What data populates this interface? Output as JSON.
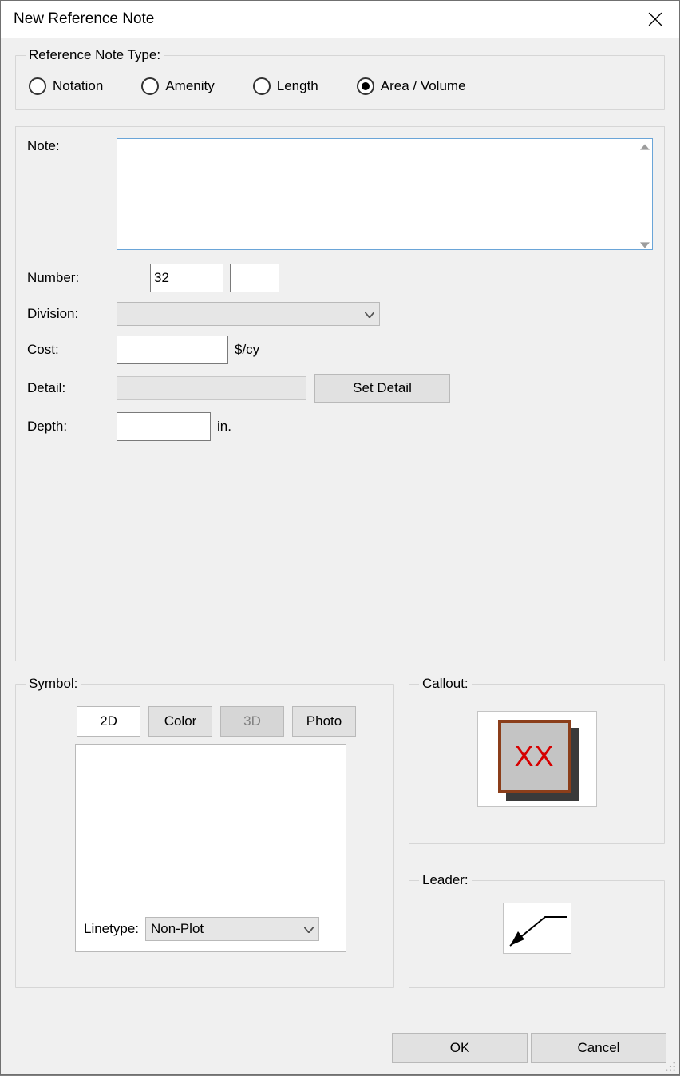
{
  "window": {
    "title": "New Reference Note"
  },
  "refTypeGroup": {
    "legend": "Reference Note Type:",
    "options": {
      "notation": "Notation",
      "amenity": "Amenity",
      "length": "Length",
      "area_volume": "Area / Volume"
    },
    "selected": "area_volume"
  },
  "form": {
    "note_label": "Note:",
    "note_value": "",
    "number_label": "Number:",
    "number_value": "32",
    "number_suffix_value": "",
    "division_label": "Division:",
    "division_value": "",
    "cost_label": "Cost:",
    "cost_value": "",
    "cost_unit": "$/cy",
    "detail_label": "Detail:",
    "detail_value": "",
    "set_detail_label": "Set Detail",
    "depth_label": "Depth:",
    "depth_value": "",
    "depth_unit": "in."
  },
  "symbol": {
    "legend": "Symbol:",
    "tabs": {
      "t2d": "2D",
      "color": "Color",
      "t3d": "3D",
      "photo": "Photo"
    },
    "active_tab": "t2d",
    "linetype_label": "Linetype:",
    "linetype_value": "Non-Plot"
  },
  "callout": {
    "legend": "Callout:",
    "text": "XX"
  },
  "leader": {
    "legend": "Leader:"
  },
  "footer": {
    "ok": "OK",
    "cancel": "Cancel"
  }
}
